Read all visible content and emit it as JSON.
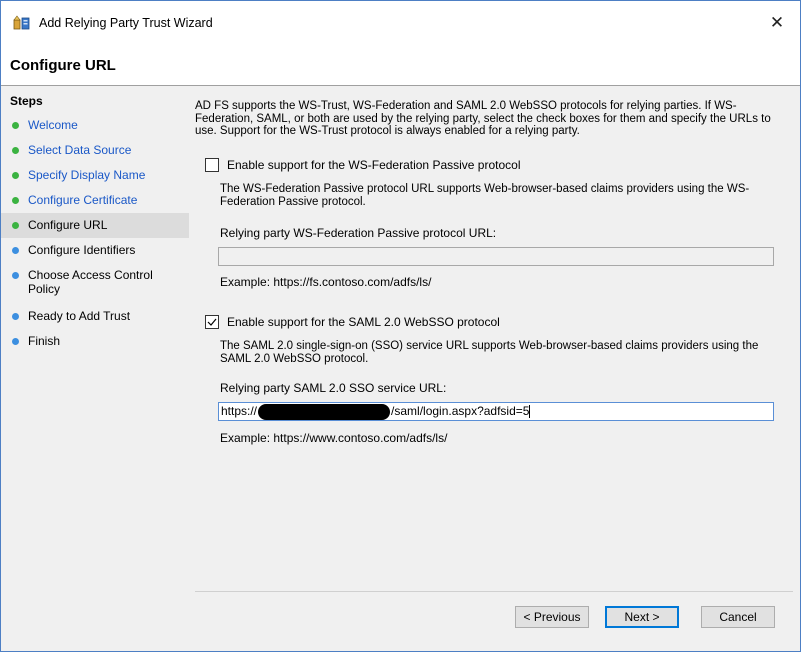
{
  "window": {
    "title": "Add Relying Party Trust Wizard",
    "close_label": "✕"
  },
  "header": {
    "page_title": "Configure URL"
  },
  "steps": {
    "title": "Steps",
    "items": [
      {
        "label": "Welcome",
        "status": "done"
      },
      {
        "label": "Select Data Source",
        "status": "done"
      },
      {
        "label": "Specify Display Name",
        "status": "done"
      },
      {
        "label": "Configure Certificate",
        "status": "done"
      },
      {
        "label": "Configure URL",
        "status": "current"
      },
      {
        "label": "Configure Identifiers",
        "status": "pending"
      },
      {
        "label": "Choose Access Control Policy",
        "status": "pending"
      },
      {
        "label": "Ready to Add Trust",
        "status": "pending"
      },
      {
        "label": "Finish",
        "status": "pending"
      }
    ]
  },
  "main": {
    "intro": "AD FS supports the WS-Trust, WS-Federation and SAML 2.0 WebSSO protocols for relying parties.  If WS-Federation, SAML, or both are used by the relying party, select the check boxes for them and specify the URLs to use.  Support for the WS-Trust protocol is always enabled for a relying party.",
    "wsfed": {
      "checkbox_label": "Enable support for the WS-Federation Passive protocol",
      "checked": false,
      "description": "The WS-Federation Passive protocol URL supports Web-browser-based claims providers using the WS-Federation Passive protocol.",
      "field_label": "Relying party WS-Federation Passive protocol URL:",
      "value": "",
      "example": "Example: https://fs.contoso.com/adfs/ls/"
    },
    "saml": {
      "checkbox_label": "Enable support for the SAML 2.0 WebSSO protocol",
      "checked": true,
      "description": "The SAML 2.0 single-sign-on (SSO) service URL supports Web-browser-based claims providers using the SAML 2.0 WebSSO protocol.",
      "field_label": "Relying party SAML 2.0 SSO service URL:",
      "value_prefix": "https://",
      "value_suffix": "/saml/login.aspx?adfsid=5",
      "example": "Example: https://www.contoso.com/adfs/ls/"
    }
  },
  "footer": {
    "previous_label": "< Previous",
    "next_label": "Next >",
    "cancel_label": "Cancel"
  },
  "colors": {
    "done_dot": "#3bb341",
    "pending_dot": "#3c8fe0",
    "link": "#1a58c7",
    "accent": "#0078d7"
  }
}
